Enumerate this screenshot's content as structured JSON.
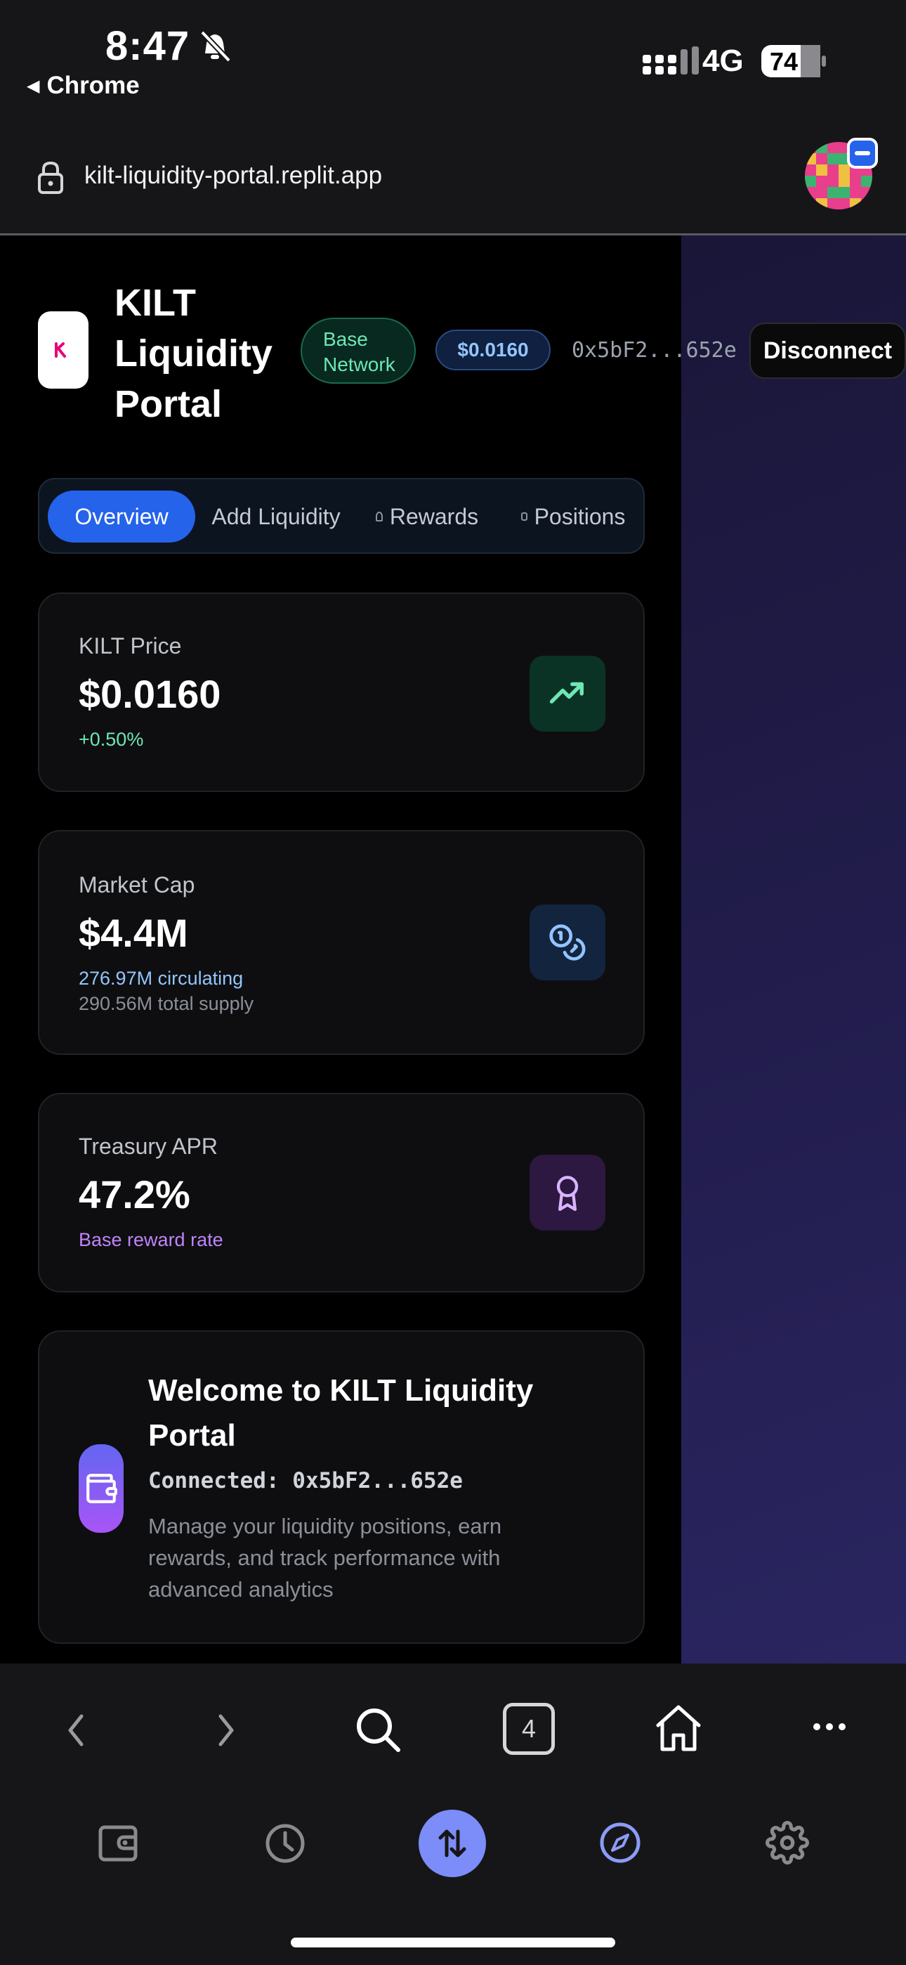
{
  "status_bar": {
    "time": "8:47",
    "network": "4G",
    "battery": "74",
    "back_app": "Chrome"
  },
  "browser": {
    "url": "kilt-liquidity-portal.replit.app",
    "tab_count": "4"
  },
  "header": {
    "brand_title": "KILT Liquidity Portal",
    "network_badge": "Base Network",
    "price_badge": "$0.0160",
    "wallet_address": "0x5bF2...652e",
    "disconnect_label": "Disconnect"
  },
  "tabs": [
    {
      "label": "Overview",
      "active": true
    },
    {
      "label": "Add Liquidity",
      "active": false
    },
    {
      "label": "Rewards",
      "active": false
    },
    {
      "label": "Positions",
      "active": false
    }
  ],
  "cards": {
    "price": {
      "label": "KILT Price",
      "value": "$0.0160",
      "change": "+0.50%",
      "icon": "trending-up-icon"
    },
    "market_cap": {
      "label": "Market Cap",
      "value": "$4.4M",
      "circulating": "276.97M circulating",
      "total_supply": "290.56M total supply",
      "icon": "coins-icon"
    },
    "treasury": {
      "label": "Treasury APR",
      "value": "47.2%",
      "sub": "Base reward rate",
      "icon": "award-icon"
    }
  },
  "welcome": {
    "title": "Welcome to KILT Liquidity Portal",
    "connected": "Connected: 0x5bF2...652e",
    "description": "Manage your liquidity positions, earn rewards, and track performance with advanced analytics"
  },
  "colors": {
    "accent": "#2563eb",
    "green": "#6ee7b7",
    "blue": "#93c5fd",
    "purple": "#c084fc",
    "logo_pink": "#e6007a"
  }
}
